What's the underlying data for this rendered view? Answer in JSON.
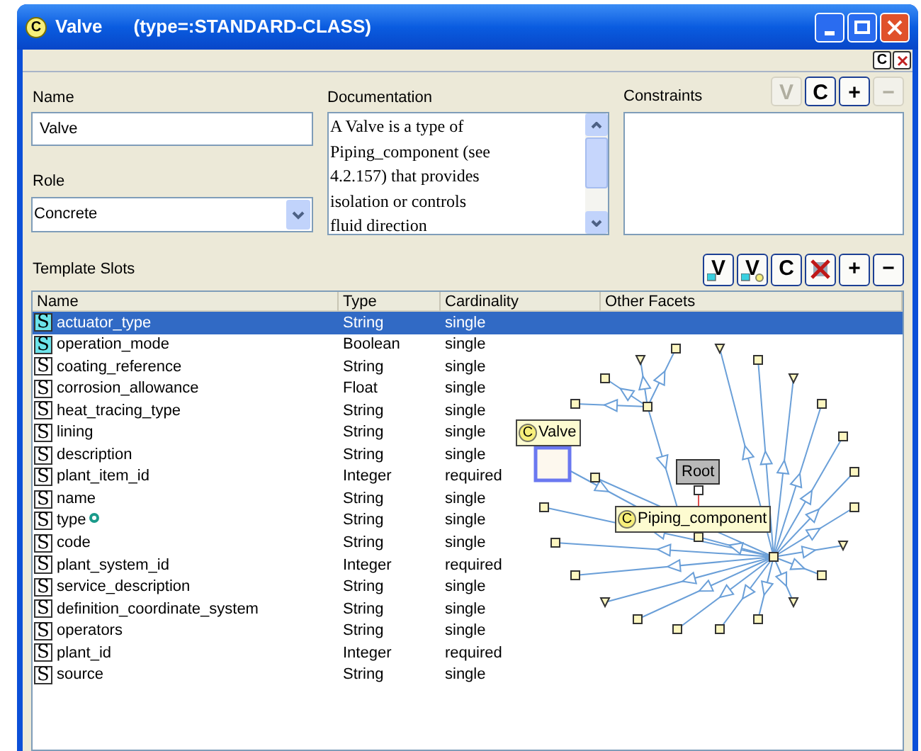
{
  "window": {
    "icon_letter": "C",
    "title": "Valve",
    "subtitle": "(type=:STANDARD-CLASS)"
  },
  "toolbar": {
    "buttons": [
      {
        "label": "C",
        "kind": "text"
      },
      {
        "kind": "close"
      }
    ]
  },
  "name_field": {
    "label": "Name",
    "value": "Valve"
  },
  "role_field": {
    "label": "Role",
    "value": "Concrete"
  },
  "documentation": {
    "label": "Documentation",
    "lines": [
      "A Valve is a type of",
      "Piping_component (see",
      "4.2.157) that provides",
      "isolation or controls",
      "fluid direction"
    ]
  },
  "constraints": {
    "label": "Constraints",
    "buttons": [
      {
        "label": "V",
        "disabled": true
      },
      {
        "label": "C",
        "disabled": false
      },
      {
        "label": "+",
        "disabled": false
      },
      {
        "label": "−",
        "disabled": true
      }
    ]
  },
  "template_slots": {
    "label": "Template Slots",
    "buttons": [
      {
        "kind": "view",
        "label": "V"
      },
      {
        "kind": "view_top",
        "label": "V"
      },
      {
        "kind": "text",
        "label": "C"
      },
      {
        "kind": "remove"
      },
      {
        "kind": "text",
        "label": "+"
      },
      {
        "kind": "text",
        "label": "−"
      }
    ],
    "columns": [
      "Name",
      "Type",
      "Cardinality",
      "Other Facets"
    ],
    "rows": [
      {
        "icon": "S",
        "overridden": true,
        "note": false,
        "selected": true,
        "name": "actuator_type",
        "type": "String",
        "cardinality": "single"
      },
      {
        "icon": "S",
        "overridden": true,
        "note": false,
        "selected": false,
        "name": "operation_mode",
        "type": "Boolean",
        "cardinality": "single"
      },
      {
        "icon": "S",
        "overridden": false,
        "note": false,
        "selected": false,
        "name": "coating_reference",
        "type": "String",
        "cardinality": "single"
      },
      {
        "icon": "S",
        "overridden": false,
        "note": false,
        "selected": false,
        "name": "corrosion_allowance",
        "type": "Float",
        "cardinality": "single"
      },
      {
        "icon": "S",
        "overridden": false,
        "note": false,
        "selected": false,
        "name": "heat_tracing_type",
        "type": "String",
        "cardinality": "single"
      },
      {
        "icon": "S",
        "overridden": false,
        "note": false,
        "selected": false,
        "name": "lining",
        "type": "String",
        "cardinality": "single"
      },
      {
        "icon": "S",
        "overridden": false,
        "note": false,
        "selected": false,
        "name": "description",
        "type": "String",
        "cardinality": "single"
      },
      {
        "icon": "S",
        "overridden": false,
        "note": false,
        "selected": false,
        "name": "plant_item_id",
        "type": "Integer",
        "cardinality": "required"
      },
      {
        "icon": "S",
        "overridden": false,
        "note": false,
        "selected": false,
        "name": "name",
        "type": "String",
        "cardinality": "single"
      },
      {
        "icon": "S",
        "overridden": false,
        "note": true,
        "selected": false,
        "name": "type",
        "type": "String",
        "cardinality": "single"
      },
      {
        "icon": "S",
        "overridden": false,
        "note": false,
        "selected": false,
        "name": "code",
        "type": "String",
        "cardinality": "single"
      },
      {
        "icon": "S",
        "overridden": false,
        "note": false,
        "selected": false,
        "name": "plant_system_id",
        "type": "Integer",
        "cardinality": "required"
      },
      {
        "icon": "S",
        "overridden": false,
        "note": false,
        "selected": false,
        "name": "service_description",
        "type": "String",
        "cardinality": "single"
      },
      {
        "icon": "S",
        "overridden": false,
        "note": false,
        "selected": false,
        "name": "definition_coordinate_system",
        "type": "String",
        "cardinality": "single"
      },
      {
        "icon": "S",
        "overridden": false,
        "note": false,
        "selected": false,
        "name": "operators",
        "type": "String",
        "cardinality": "single"
      },
      {
        "icon": "S",
        "overridden": false,
        "note": false,
        "selected": false,
        "name": "plant_id",
        "type": "Integer",
        "cardinality": "required"
      },
      {
        "icon": "S",
        "overridden": false,
        "note": false,
        "selected": false,
        "name": "source",
        "type": "String",
        "cardinality": "single"
      }
    ]
  },
  "graph": {
    "nodes": [
      {
        "kind": "class",
        "icon_letter": "C",
        "label": "Valve"
      },
      {
        "kind": "root",
        "label": "Root"
      },
      {
        "kind": "class",
        "icon_letter": "C",
        "label": "Piping_component"
      }
    ]
  }
}
